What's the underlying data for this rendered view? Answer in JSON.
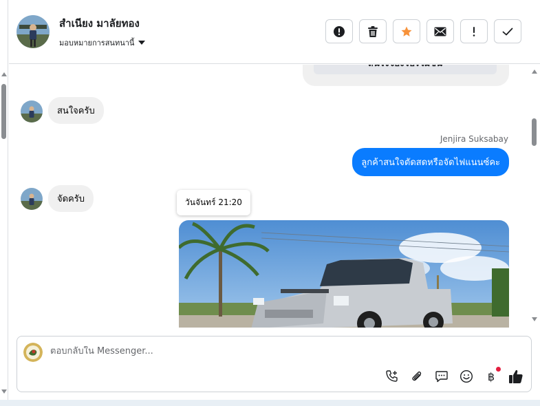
{
  "header": {
    "contact_name": "สำเนียง มาลัยทอง",
    "assign_label": "มอบหมายการสนทนานี้",
    "actions": [
      {
        "icon": "alert-circle-icon",
        "name": "mark-spam-button"
      },
      {
        "icon": "trash-icon",
        "name": "delete-button"
      },
      {
        "icon": "star-icon",
        "name": "star-button"
      },
      {
        "icon": "envelope-icon",
        "name": "mark-unread-button"
      },
      {
        "icon": "exclamation-icon",
        "name": "follow-up-button"
      },
      {
        "icon": "check-icon",
        "name": "mark-done-button"
      }
    ],
    "star_color": "#f7923a"
  },
  "messages": {
    "previous_card_text": "สนใจจองโปรโมชั่น",
    "msg1": "สนใจครับ",
    "sender_name": "Jenjira Suksabay",
    "msg2": "ลูกค้าสนใจตัดสดหรือจัดไฟแนนซ์คะ",
    "msg3": "จัดครับ",
    "timestamp_tooltip": "วันจันทร์ 21:20",
    "outgoing_color": "#0a7cff"
  },
  "composer": {
    "placeholder": "ตอบกลับใน Messenger...",
    "tools": [
      "phone-plus-icon",
      "paperclip-icon",
      "chat-bubble-icon",
      "smiley-icon",
      "baht-icon",
      "thumbs-up-icon"
    ],
    "baht_symbol": "฿"
  }
}
